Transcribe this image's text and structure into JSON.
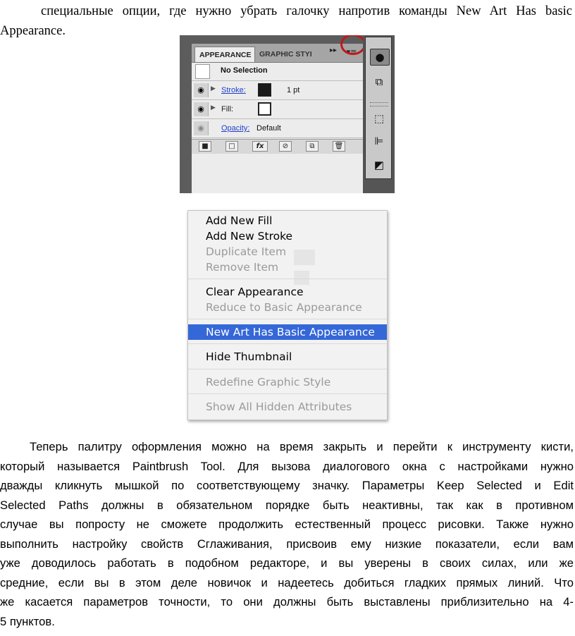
{
  "intro_text": {
    "line1": "специальные опции, где нужно убрать галочку напротив команды New Art Has basic",
    "line2": "Appearance."
  },
  "appearance_panel": {
    "tabs": [
      "APPEARANCE",
      "GRAPHIC STYLI"
    ],
    "forward_icon": "double-chevron-right-icon",
    "menu_icon": "panel-menu-icon",
    "no_selection": "No Selection",
    "rows": [
      {
        "label": "Stroke:",
        "value": "1 pt"
      },
      {
        "label": "Fill:",
        "value": ""
      },
      {
        "label": "Opacity:",
        "value": "Default"
      }
    ],
    "highlight_color": "#c01818"
  },
  "flyout_menu": {
    "items": [
      {
        "label": "Add New Fill",
        "state": "enabled"
      },
      {
        "label": "Add New Stroke",
        "state": "enabled"
      },
      {
        "label": "Duplicate Item",
        "state": "disabled"
      },
      {
        "label": "Remove Item",
        "state": "disabled"
      },
      {
        "label": "Clear Appearance",
        "state": "enabled"
      },
      {
        "label": "Reduce to Basic Appearance",
        "state": "disabled"
      },
      {
        "label": "New Art Has Basic Appearance",
        "state": "highlighted"
      },
      {
        "label": "Hide Thumbnail",
        "state": "enabled"
      },
      {
        "label": "Redefine Graphic Style",
        "state": "disabled"
      },
      {
        "label": "Show All Hidden Attributes",
        "state": "disabled"
      }
    ],
    "highlight_color": "#3467d8"
  },
  "body_text": {
    "lines": [
      "Теперь палитру оформления можно на время закрыть и перейти к инструменту кисти,",
      "который называется Paintbrush Tool. Для вызова диалогового окна с настройками нужно",
      "дважды кликнуть мышкой по соответствующему значку. Параметры Keep Selected и Edit",
      "Selected Paths должны в обязательном порядке быть неактивны, так как в противном",
      "случае вы попросту не сможете продолжить естественный процесс рисовки. Также нужно",
      "выполнить настройку свойств Сглаживания, присвоив ему низкие показатели, если вам",
      "уже доводилось работать в подобном редакторе, и вы уверены в своих силах, или же",
      "средние, если вы в этом деле новичок и надеетесь добиться гладких прямых линий. Что",
      "же касается параметров точности, то они должны быть выставлены приблизительно на 4-",
      "5 пунктов."
    ]
  }
}
